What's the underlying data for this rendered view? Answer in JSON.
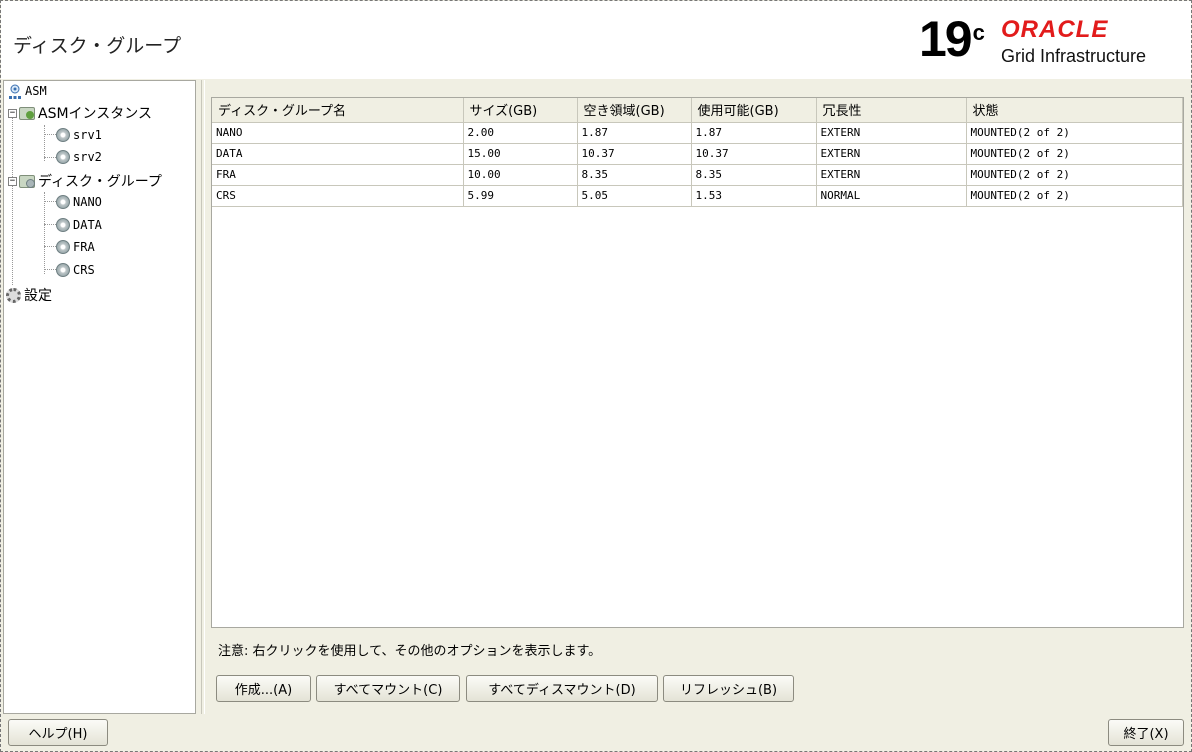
{
  "header": {
    "title": "ディスク・グループ",
    "version": "19",
    "version_sup": "c",
    "brand": "ORACLE",
    "product": "Grid Infrastructure"
  },
  "tree": {
    "root": "ASM",
    "instances_label": "ASMインスタンス",
    "instances": [
      "srv1",
      "srv2"
    ],
    "diskgroups_label": "ディスク・グループ",
    "diskgroups": [
      "NANO",
      "DATA",
      "FRA",
      "CRS"
    ],
    "settings_label": "設定"
  },
  "table": {
    "headers": [
      "ディスク・グループ名",
      "サイズ(GB)",
      "空き領域(GB)",
      "使用可能(GB)",
      "冗長性",
      "状態"
    ],
    "rows": [
      [
        "NANO",
        "2.00",
        "1.87",
        "1.87",
        "EXTERN",
        "MOUNTED(2 of 2)"
      ],
      [
        "DATA",
        "15.00",
        "10.37",
        "10.37",
        "EXTERN",
        "MOUNTED(2 of 2)"
      ],
      [
        "FRA",
        "10.00",
        "8.35",
        "8.35",
        "EXTERN",
        "MOUNTED(2 of 2)"
      ],
      [
        "CRS",
        "5.99",
        "5.05",
        "1.53",
        "NORMAL",
        "MOUNTED(2 of 2)"
      ]
    ]
  },
  "note": "注意: 右クリックを使用して、その他のオプションを表示します。",
  "buttons": {
    "create": "作成...(A)",
    "mount_all": "すべてマウント(C)",
    "dismount_all": "すべてディスマウント(D)",
    "refresh": "リフレッシュ(B)",
    "help": "ヘルプ(H)",
    "exit": "終了(X)"
  },
  "colors": {
    "brand_red": "#e21b1b",
    "background": "#f0efe3"
  }
}
